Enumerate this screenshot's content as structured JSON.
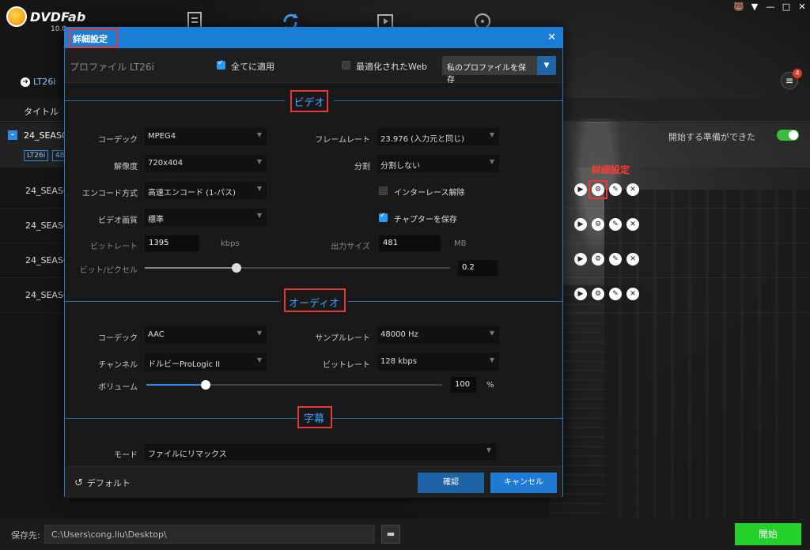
{
  "app": {
    "logo_text": "DVDFab",
    "version": "10.0",
    "window_controls": [
      "🐻",
      "▼",
      "—",
      "□",
      "✕"
    ]
  },
  "source_link": {
    "label": "LT26i"
  },
  "queue_badge": "4",
  "list_header": {
    "title_col": "タイトル"
  },
  "season": {
    "title": "24_SEASO",
    "tags": [
      "LT26i",
      "48"
    ],
    "ready_label": "開始する準備ができた"
  },
  "episodes": [
    {
      "title": "24_SEASO"
    },
    {
      "title": "24_SEASO"
    },
    {
      "title": "24_SEASO"
    },
    {
      "title": "24_SEASO"
    }
  ],
  "annotation": {
    "label": "詳細設定"
  },
  "bottom": {
    "save_label": "保存先:",
    "save_path": "C:\\Users\\cong.liu\\Desktop\\",
    "start_label": "開始"
  },
  "dialog": {
    "title": "詳細設定",
    "profile_label": "プロファイル LT26i",
    "apply_all_label": "全てに適用",
    "apply_all_checked": true,
    "web_optimized_label": "最適化されたWeb",
    "web_optimized_checked": false,
    "save_profile_label": "私のプロファイルを保存",
    "video": {
      "section_title": "ビデオ",
      "codec_label": "コーデック",
      "codec_value": "MPEG4",
      "framerate_label": "フレームレート",
      "framerate_value": "23.976 (入力元と同じ)",
      "resolution_label": "解像度",
      "resolution_value": "720x404",
      "split_label": "分割",
      "split_value": "分割しない",
      "encode_label": "エンコード方式",
      "encode_value": "高速エンコード (1-パス)",
      "deinterlace_label": "インターレース解除",
      "deinterlace_checked": false,
      "quality_label": "ビデオ画質",
      "quality_value": "標準",
      "chapter_label": "チャプターを保存",
      "chapter_checked": true,
      "bitrate_label": "ビットレート",
      "bitrate_value": "1395",
      "bitrate_unit": "kbps",
      "outsize_label": "出力サイズ",
      "outsize_value": "481",
      "outsize_unit": "MB",
      "bpp_label": "ビット/ピクセル",
      "bpp_value": "0.2",
      "bpp_slider_fraction": 0.3
    },
    "audio": {
      "section_title": "オーディオ",
      "codec_label": "コーデック",
      "codec_value": "AAC",
      "samplerate_label": "サンプルレート",
      "samplerate_value": "48000 Hz",
      "channel_label": "チャンネル",
      "channel_value": "ドルビーProLogic II",
      "bitrate_label": "ビットレート",
      "bitrate_value": "128 kbps",
      "volume_label": "ボリューム",
      "volume_value": "100",
      "volume_unit": "%",
      "volume_slider_fraction": 0.2
    },
    "subtitle": {
      "section_title": "字幕",
      "mode_label": "モード",
      "mode_value": "ファイルにリマックス"
    },
    "default_label": "デフォルト",
    "ok_label": "確認",
    "cancel_label": "キャンセル"
  },
  "colors": {
    "accent": "#1a7ed6",
    "annotation": "#e53935",
    "start": "#24d12b",
    "toggle_on": "#3dbd3d"
  }
}
